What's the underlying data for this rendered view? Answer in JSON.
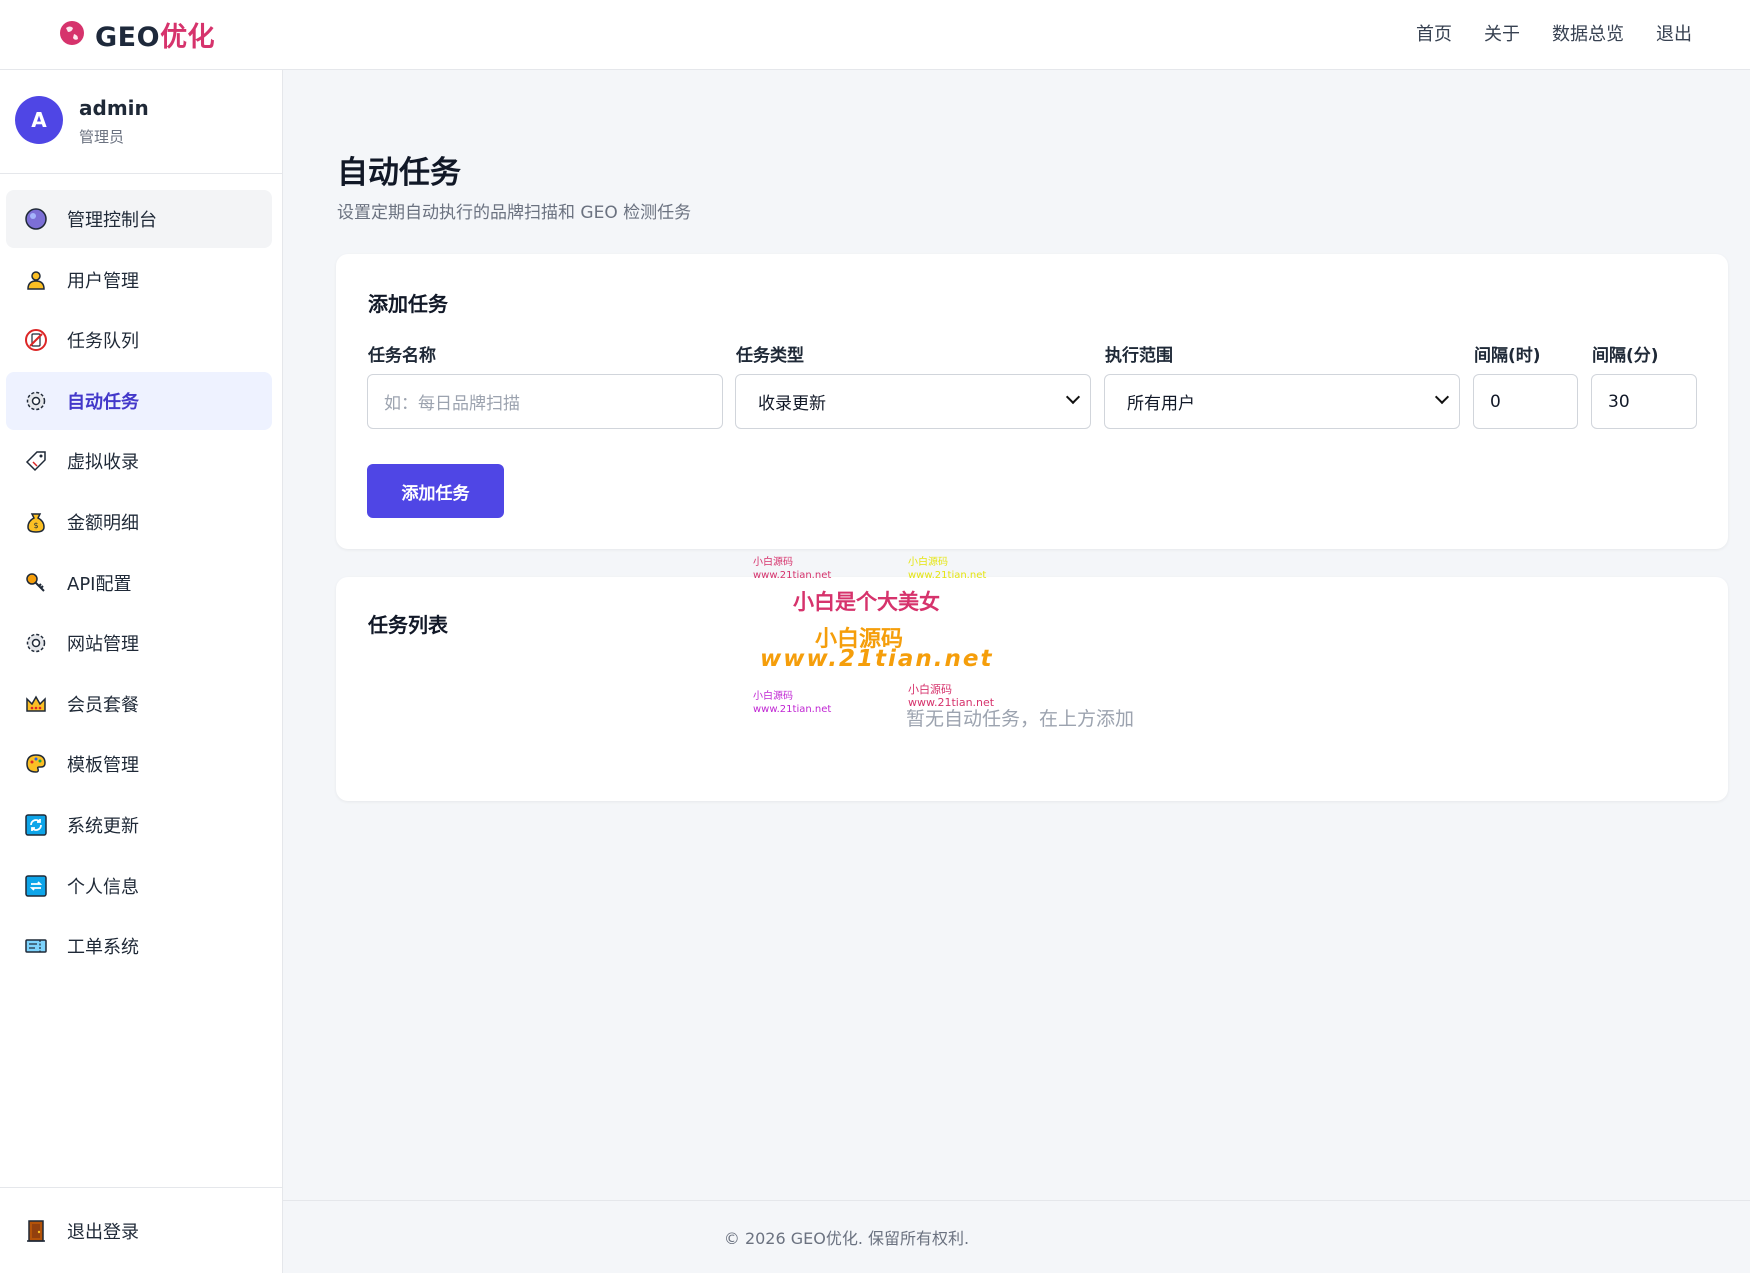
{
  "brand": {
    "prefix": "GEO",
    "suffix": "优化"
  },
  "topnav": [
    "首页",
    "关于",
    "数据总览",
    "退出"
  ],
  "user": {
    "avatar_letter": "A",
    "name": "admin",
    "role": "管理员"
  },
  "menu": [
    {
      "label": "管理控制台",
      "icon": "dashboard-icon"
    },
    {
      "label": "用户管理",
      "icon": "user-icon"
    },
    {
      "label": "任务队列",
      "icon": "queue-icon"
    },
    {
      "label": "自动任务",
      "icon": "gear-icon"
    },
    {
      "label": "虚拟收录",
      "icon": "tag-icon"
    },
    {
      "label": "金额明细",
      "icon": "money-bag-icon"
    },
    {
      "label": "API配置",
      "icon": "key-icon"
    },
    {
      "label": "网站管理",
      "icon": "gear-icon"
    },
    {
      "label": "会员套餐",
      "icon": "crown-icon"
    },
    {
      "label": "模板管理",
      "icon": "palette-icon"
    },
    {
      "label": "系统更新",
      "icon": "refresh-icon"
    },
    {
      "label": "个人信息",
      "icon": "repeat-icon"
    },
    {
      "label": "工单系统",
      "icon": "ticket-icon"
    }
  ],
  "logout_label": "退出登录",
  "page": {
    "title": "自动任务",
    "subtitle": "设置定期自动执行的品牌扫描和 GEO 检测任务"
  },
  "add_card": {
    "title": "添加任务",
    "name_label": "任务名称",
    "name_placeholder": "如：每日品牌扫描",
    "type_label": "任务类型",
    "type_value": "收录更新",
    "scope_label": "执行范围",
    "scope_value": "所有用户",
    "hours_label": "间隔(时)",
    "hours_value": "0",
    "minutes_label": "间隔(分)",
    "minutes_value": "30",
    "button": "添加任务"
  },
  "list_card": {
    "title": "任务列表",
    "empty": "暂无自动任务，在上方添加"
  },
  "watermark": {
    "small_a": "小白源码",
    "small_url": "www.21tian.net",
    "main": "小白是个大美女",
    "mid": "小白源码",
    "url": "www.21tian.net"
  },
  "footer": "© 2026 GEO优化. 保留所有权利.",
  "colors": {
    "accent": "#4f46e5",
    "brand": "#d6336c"
  }
}
